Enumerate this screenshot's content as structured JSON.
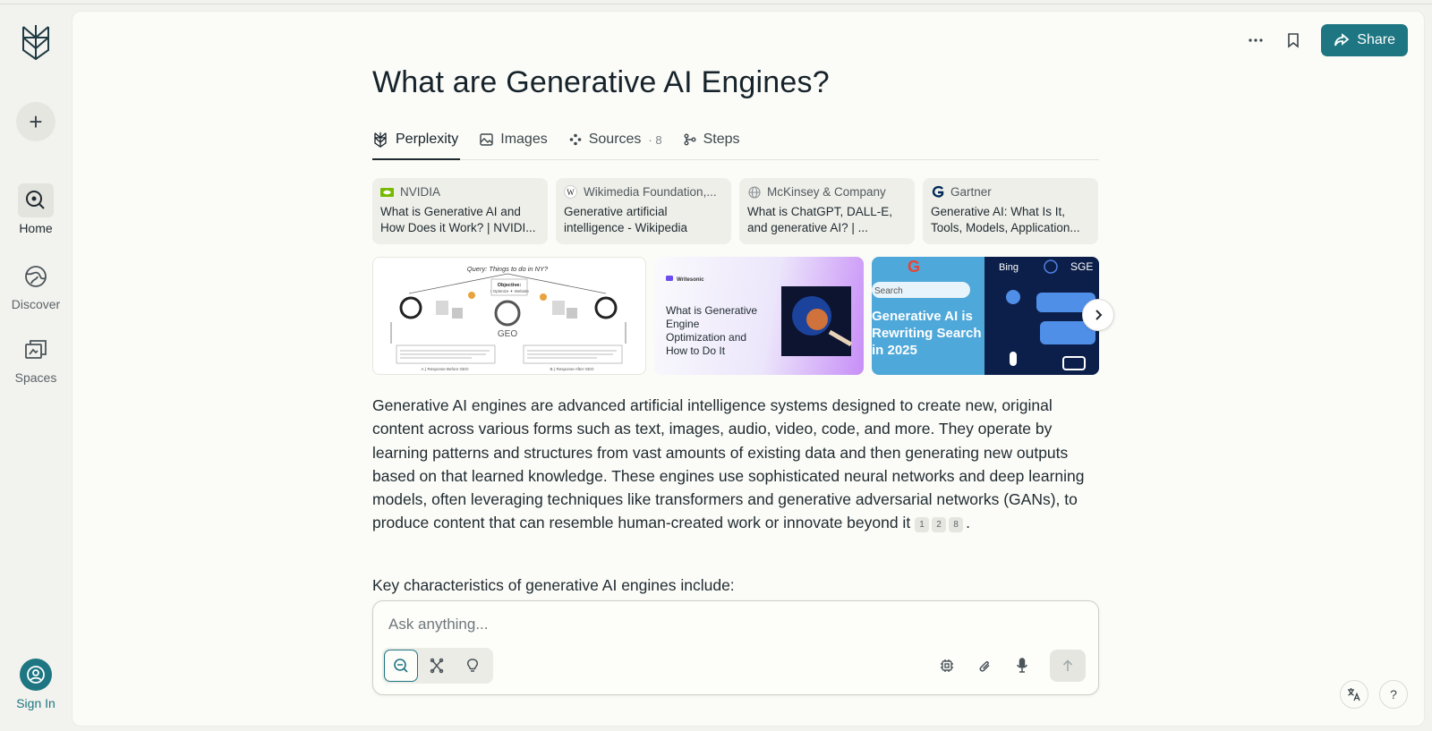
{
  "sidebar": {
    "new_thread_symbol": "+",
    "items": [
      {
        "label": "Home",
        "icon": "home-search-icon",
        "active": true
      },
      {
        "label": "Discover",
        "icon": "globe-icon",
        "active": false
      },
      {
        "label": "Spaces",
        "icon": "spaces-icon",
        "active": false
      }
    ],
    "sign_in": "Sign In"
  },
  "header": {
    "more_icon": "more-horizontal-icon",
    "bookmark_icon": "bookmark-icon",
    "share_label": "Share"
  },
  "title": "What are Generative AI Engines?",
  "tabs": [
    {
      "label": "Perplexity",
      "active": true
    },
    {
      "label": "Images"
    },
    {
      "label": "Sources",
      "count": "· 8"
    },
    {
      "label": "Steps"
    }
  ],
  "sources": [
    {
      "site": "NVIDIA",
      "title": "What is Generative AI and How Does it Work? | NVIDI..."
    },
    {
      "site": "Wikimedia Foundation,...",
      "title": "Generative artificial intelligence - Wikipedia"
    },
    {
      "site": "McKinsey & Company",
      "title": "What is ChatGPT, DALL-E, and generative AI? | ..."
    },
    {
      "site": "Gartner",
      "title": "Generative AI: What Is It, Tools, Models, Application..."
    }
  ],
  "images": {
    "img1": {
      "query": "Query: Things to do in NY?",
      "objective": "Objective:",
      "objective_sub": "↑ Optimize ✦ Website",
      "center": "GEO",
      "left_caption": "A.) Response Before GEO",
      "right_caption": "B.) Response After GEO"
    },
    "img2": {
      "brand": "Writesonic",
      "text": "What is Generative Engine Optimization and How to Do It"
    },
    "img3": {
      "search": "Search",
      "text": "Generative AI is Rewriting Search in 2025",
      "bing": "Bing",
      "sge": "SGE"
    }
  },
  "answer": {
    "paragraph": "Generative AI engines are advanced artificial intelligence systems designed to create new, original content across various forms such as text, images, audio, video, code, and more. They operate by learning patterns and structures from vast amounts of existing data and then generating new outputs based on that learned knowledge. These engines use sophisticated neural networks and deep learning models, often leveraging techniques like transformers and generative adversarial networks (GANs), to produce content that can resemble human-created work or innovate beyond it",
    "citations": [
      "1",
      "2",
      "8"
    ],
    "period": ".",
    "key_heading": "Key characteristics of generative AI engines include:"
  },
  "ask": {
    "placeholder": "Ask anything...",
    "modes": [
      "search-mode-icon",
      "research-mode-icon",
      "labs-mode-icon"
    ],
    "tools": [
      "model-chip-icon",
      "attach-icon",
      "microphone-icon",
      "submit-arrow-icon"
    ]
  },
  "corner": {
    "translate_icon": "translate-icon",
    "help": "?"
  },
  "colors": {
    "accent": "#1d7682",
    "background": "#f2f2ee",
    "panel": "#fbfbf7"
  }
}
